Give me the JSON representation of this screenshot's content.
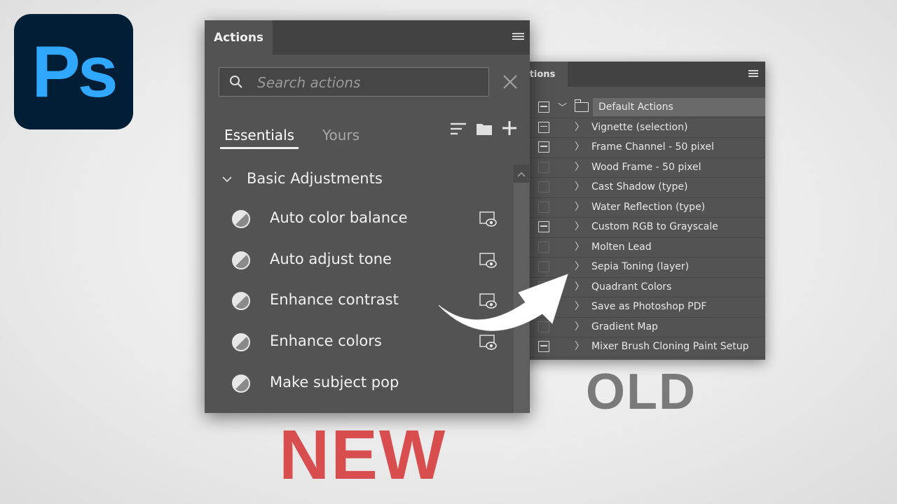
{
  "logo": {
    "text": "Ps"
  },
  "new_panel": {
    "tab_title": "Actions",
    "search": {
      "placeholder": "Search actions",
      "value": ""
    },
    "tabs": [
      {
        "label": "Essentials",
        "active": true
      },
      {
        "label": "Yours",
        "active": false
      }
    ],
    "group": {
      "label": "Basic Adjustments",
      "expanded": true
    },
    "items": [
      {
        "label": "Auto color balance"
      },
      {
        "label": "Auto adjust tone"
      },
      {
        "label": "Enhance contrast"
      },
      {
        "label": "Enhance colors"
      },
      {
        "label": "Make subject pop"
      }
    ]
  },
  "old_panel": {
    "tab_title": "ctions",
    "set": {
      "label": "Default Actions"
    },
    "actions": [
      {
        "label": "Vignette (selection)",
        "toggle": true
      },
      {
        "label": "Frame Channel - 50 pixel",
        "toggle": true
      },
      {
        "label": "Wood Frame - 50 pixel",
        "toggle": false
      },
      {
        "label": "Cast Shadow (type)",
        "toggle": false
      },
      {
        "label": "Water Reflection (type)",
        "toggle": false
      },
      {
        "label": "Custom RGB to Grayscale",
        "toggle": true
      },
      {
        "label": "Molten Lead",
        "toggle": false
      },
      {
        "label": "Sepia Toning (layer)",
        "toggle": false
      },
      {
        "label": "Quadrant Colors",
        "toggle": false
      },
      {
        "label": "Save as Photoshop PDF",
        "toggle": false
      },
      {
        "label": "Gradient Map",
        "toggle": false
      },
      {
        "label": "Mixer Brush Cloning Paint Setup",
        "toggle": true
      }
    ]
  },
  "labels": {
    "new": "NEW",
    "old": "OLD"
  },
  "colors": {
    "ps_bg": "#001e36",
    "ps_text": "#31a8ff",
    "new_label": "#d84e4e",
    "old_label": "#7a7a7a",
    "panel": "#535353"
  }
}
